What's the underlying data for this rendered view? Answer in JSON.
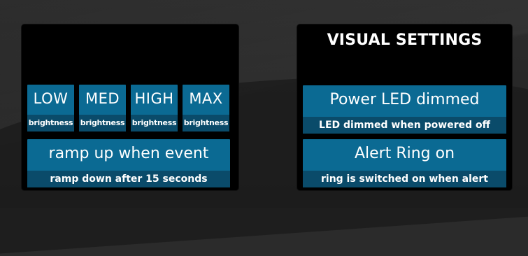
{
  "colors": {
    "background": "#2b2b2b",
    "panel": "#000000",
    "tile_primary": "#0b6a93",
    "tile_secondary": "#0a4b6a",
    "text": "#ffffff"
  },
  "left_panel": {
    "brightness_buttons": [
      {
        "label": "LOW",
        "sub": "brightness"
      },
      {
        "label": "MED",
        "sub": "brightness"
      },
      {
        "label": "HIGH",
        "sub": "brightness"
      },
      {
        "label": "MAX",
        "sub": "brightness"
      }
    ],
    "ramp_button": {
      "label": "ramp up when event",
      "sub": "ramp down after 15 seconds"
    }
  },
  "right_panel": {
    "title": "VISUAL SETTINGS",
    "power_led_button": {
      "label": "Power LED dimmed",
      "sub": "LED dimmed when powered off"
    },
    "alert_ring_button": {
      "label": "Alert Ring on",
      "sub": "ring is switched on when alert"
    }
  }
}
